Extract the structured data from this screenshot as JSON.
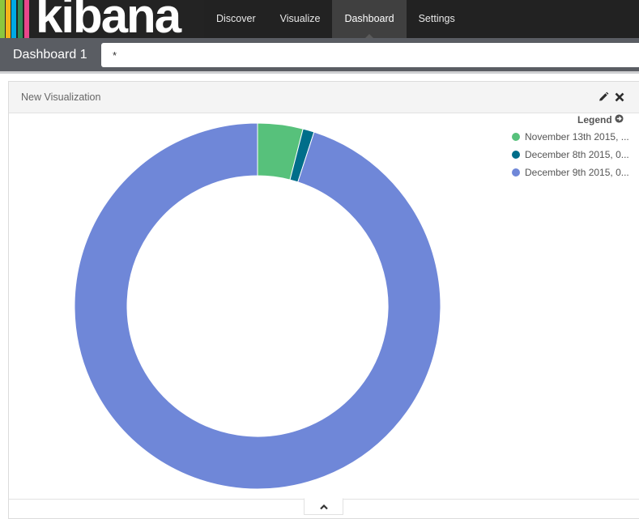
{
  "brand": {
    "name": "kibana",
    "bar_colors": [
      "#8cc63f",
      "#f4b41a",
      "#00a9e5",
      "#2e8b57",
      "#e8478b"
    ]
  },
  "nav": {
    "tabs": [
      {
        "label": "Discover",
        "active": false
      },
      {
        "label": "Visualize",
        "active": false
      },
      {
        "label": "Dashboard",
        "active": true
      },
      {
        "label": "Settings",
        "active": false
      }
    ]
  },
  "dashboard": {
    "title": "Dashboard 1",
    "query_value": "*"
  },
  "panel": {
    "title": "New Visualization",
    "actions": [
      "edit-icon",
      "close-icon"
    ],
    "legend_label": "Legend"
  },
  "colors": {
    "navbar": "#222222",
    "query_bar": "#5a5d63",
    "donut_green": "#57c17b",
    "donut_teal": "#006e8a",
    "donut_blue": "#6f87d8"
  },
  "chart_data": {
    "type": "pie",
    "donut": true,
    "title": "",
    "legend_position": "top-right",
    "categories": [
      "November 13th 2015, ...",
      "December 8th 2015, 0...",
      "December 9th 2015, 0..."
    ],
    "series": [
      {
        "values": [
          4,
          1,
          95
        ]
      }
    ],
    "colors": [
      "#57c17b",
      "#006e8a",
      "#6f87d8"
    ]
  }
}
